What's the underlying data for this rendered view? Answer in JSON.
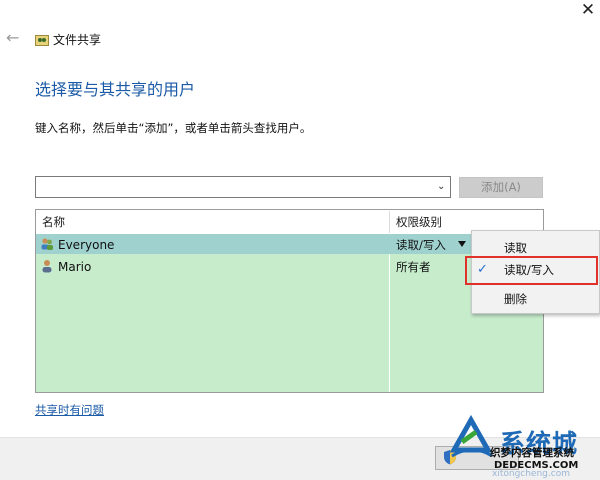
{
  "window": {
    "close_glyph": "✕",
    "title": "文件共享",
    "back_glyph": "←",
    "title_icon": "folder-share-icon"
  },
  "main": {
    "heading": "选择要与其共享的用户",
    "instructions": "键入名称，然后单击“添加”，或者单击箭头查找用户。",
    "user_input_value": "",
    "add_button_label": "添加(A)",
    "help_link": "共享时有问题"
  },
  "table": {
    "columns": [
      "名称",
      "权限级别"
    ],
    "rows": [
      {
        "name": "Everyone",
        "permission": "读取/写入",
        "icon": "group-icon",
        "selected": true
      },
      {
        "name": "Mario",
        "permission": "所有者",
        "icon": "user-icon",
        "selected": false
      }
    ]
  },
  "permission_menu": {
    "items": [
      {
        "label": "读取",
        "checked": false
      },
      {
        "label": "读取/写入",
        "checked": true
      },
      {
        "label": "删除",
        "checked": false
      }
    ],
    "check_glyph": "✓",
    "highlight_color": "#e0322b"
  },
  "footer": {
    "share_button_label": "共享",
    "share_icon": "shield-icon"
  },
  "watermark": {
    "brand": "系统城",
    "line1": "织梦内容管理系统",
    "line2": "DEDECMS.COM",
    "line3": "xitongcheng.com"
  },
  "colors": {
    "accent_blue": "#1a5aa6",
    "table_fill": "#c7eccc",
    "selected_row": "#9fd2cf"
  }
}
